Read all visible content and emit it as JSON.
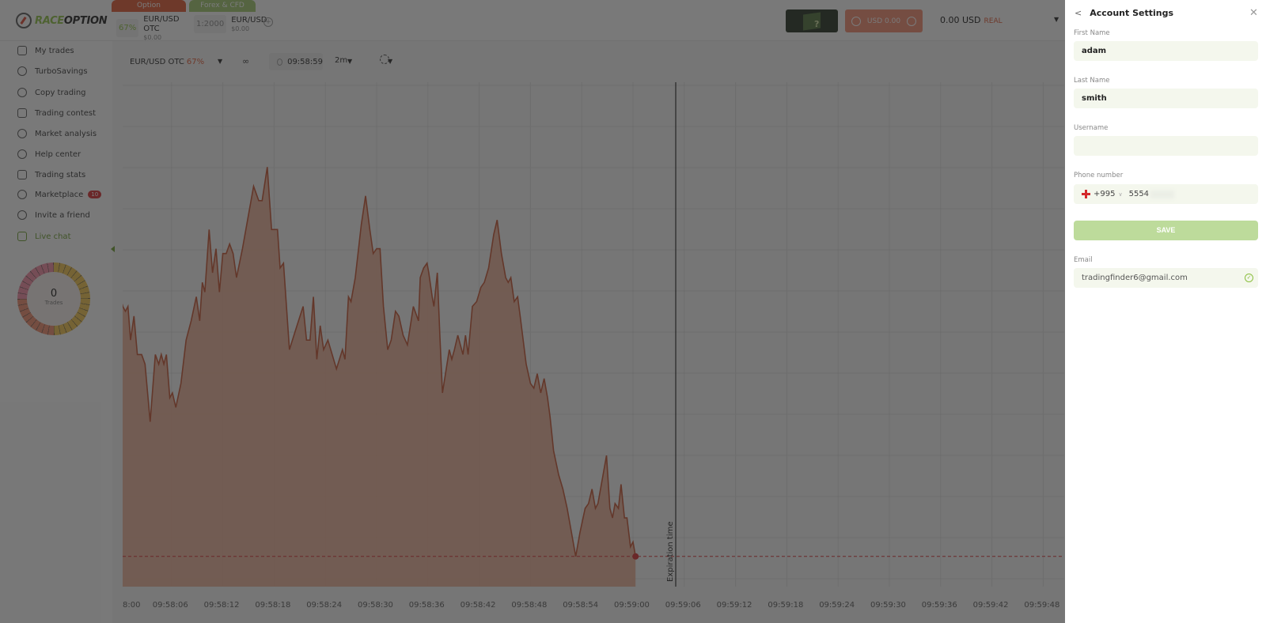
{
  "brand": {
    "name_part1": "RACE",
    "name_part2": "OPTION"
  },
  "header": {
    "tabs": [
      {
        "label": "Option",
        "payout": "67%",
        "asset": "EUR/USD OTC",
        "amount": "$0.00",
        "color": "#e0542f"
      },
      {
        "label": "Forex & CFD",
        "payout": "1:2000",
        "asset": "EUR/USD",
        "amount": "$0.00",
        "color": "#9dc56b"
      }
    ],
    "add_asset_icon": "plus-circle-icon",
    "gift_icon": "mystery-box-icon",
    "bonus_button": {
      "label": "USD 0.00"
    },
    "balance": {
      "amount": "0.00 USD",
      "account_type": "REAL"
    }
  },
  "sidebar": {
    "items": [
      {
        "label": "My trades",
        "icon": "trades-icon"
      },
      {
        "label": "TurboSavings",
        "icon": "savings-icon"
      },
      {
        "label": "Copy trading",
        "icon": "copy-trading-icon"
      },
      {
        "label": "Trading contest",
        "icon": "contest-icon"
      },
      {
        "label": "Market analysis",
        "icon": "analysis-icon"
      },
      {
        "label": "Help center",
        "icon": "help-icon"
      },
      {
        "label": "Trading stats",
        "icon": "stats-icon"
      },
      {
        "label": "Marketplace",
        "icon": "marketplace-icon",
        "badge": "10"
      },
      {
        "label": "Invite a friend",
        "icon": "invite-icon"
      },
      {
        "label": "Live chat",
        "icon": "chat-icon"
      }
    ],
    "trades_counter": {
      "count": "0",
      "label": "Trades"
    }
  },
  "chart_toolbar": {
    "symbol": "EUR/USD OTC",
    "symbol_payout": "67%",
    "timer": "09:58:59",
    "timeframe": "2m"
  },
  "chart_data": {
    "type": "area",
    "title": "EUR/USD OTC",
    "xlabel": "",
    "ylabel": "",
    "x_tick_labels": [
      "8:00",
      "09:58:06",
      "09:58:12",
      "09:58:18",
      "09:58:24",
      "09:58:30",
      "09:58:36",
      "09:58:42",
      "09:58:48",
      "09:58:54",
      "09:59:00",
      "09:59:06",
      "09:59:12",
      "09:59:18",
      "09:59:24",
      "09:59:30",
      "09:59:36",
      "09:59:42",
      "09:59:48"
    ],
    "x_range_seconds": [
      0,
      108
    ],
    "y_range": [
      0,
      100
    ],
    "grid": true,
    "annotation": "Expiration time",
    "expiration_x_seconds": 65,
    "current_level": 3,
    "series": [
      {
        "name": "price",
        "color": "#c2502e",
        "points": [
          [
            0.0,
            57
          ],
          [
            0.3,
            55
          ],
          [
            0.6,
            54
          ],
          [
            0.9,
            55
          ],
          [
            1.2,
            48
          ],
          [
            1.6,
            53
          ],
          [
            2.0,
            45
          ],
          [
            2.5,
            45
          ],
          [
            2.9,
            43
          ],
          [
            3.5,
            31
          ],
          [
            4.1,
            45
          ],
          [
            4.5,
            43
          ],
          [
            4.8,
            45
          ],
          [
            5.1,
            43
          ],
          [
            5.4,
            45
          ],
          [
            5.8,
            36
          ],
          [
            6.1,
            37
          ],
          [
            6.5,
            34
          ],
          [
            7.1,
            39
          ],
          [
            7.7,
            48
          ],
          [
            8.3,
            52
          ],
          [
            8.9,
            57
          ],
          [
            9.3,
            52
          ],
          [
            9.6,
            60
          ],
          [
            9.9,
            58
          ],
          [
            10.4,
            71
          ],
          [
            10.8,
            62
          ],
          [
            11.2,
            67
          ],
          [
            11.6,
            58
          ],
          [
            12.0,
            66
          ],
          [
            12.4,
            66
          ],
          [
            12.8,
            68
          ],
          [
            13.2,
            66
          ],
          [
            13.6,
            61
          ],
          [
            14.3,
            67
          ],
          [
            14.9,
            73
          ],
          [
            15.6,
            80
          ],
          [
            16.2,
            77
          ],
          [
            16.6,
            77
          ],
          [
            17.2,
            84
          ],
          [
            17.7,
            71
          ],
          [
            18.0,
            71
          ],
          [
            18.4,
            71
          ],
          [
            18.7,
            63
          ],
          [
            19.1,
            64
          ],
          [
            19.8,
            46
          ],
          [
            20.5,
            50
          ],
          [
            21.4,
            55
          ],
          [
            21.8,
            48
          ],
          [
            22.2,
            48
          ],
          [
            22.6,
            57
          ],
          [
            23.0,
            44
          ],
          [
            23.4,
            51
          ],
          [
            23.8,
            46
          ],
          [
            24.3,
            48
          ],
          [
            25.3,
            42
          ],
          [
            26.0,
            46
          ],
          [
            26.3,
            44
          ],
          [
            26.7,
            57
          ],
          [
            27.0,
            56
          ],
          [
            27.5,
            61
          ],
          [
            28.2,
            72
          ],
          [
            28.7,
            78
          ],
          [
            29.2,
            71
          ],
          [
            29.6,
            66
          ],
          [
            30.0,
            67
          ],
          [
            30.4,
            67
          ],
          [
            30.8,
            55
          ],
          [
            31.3,
            46
          ],
          [
            31.7,
            48
          ],
          [
            32.2,
            54
          ],
          [
            32.6,
            53
          ],
          [
            33.1,
            49
          ],
          [
            33.6,
            47
          ],
          [
            34.3,
            55
          ],
          [
            34.9,
            52
          ],
          [
            35.1,
            61
          ],
          [
            35.5,
            63
          ],
          [
            35.9,
            64
          ],
          [
            36.1,
            62
          ],
          [
            36.5,
            57
          ],
          [
            36.7,
            55
          ],
          [
            37.1,
            62
          ],
          [
            37.4,
            49
          ],
          [
            37.7,
            37
          ],
          [
            38.5,
            46
          ],
          [
            38.8,
            44
          ],
          [
            39.1,
            46
          ],
          [
            39.5,
            49
          ],
          [
            39.8,
            47
          ],
          [
            40.1,
            45
          ],
          [
            40.4,
            49
          ],
          [
            40.7,
            45
          ],
          [
            41.2,
            55
          ],
          [
            41.7,
            56
          ],
          [
            42.2,
            59
          ],
          [
            42.6,
            60
          ],
          [
            43.1,
            63
          ],
          [
            43.7,
            70
          ],
          [
            44.1,
            73
          ],
          [
            44.6,
            66
          ],
          [
            45.1,
            61
          ],
          [
            45.4,
            60
          ],
          [
            45.7,
            61
          ],
          [
            46.1,
            56
          ],
          [
            46.5,
            57
          ],
          [
            46.8,
            53
          ],
          [
            47.5,
            43
          ],
          [
            48.0,
            39
          ],
          [
            48.4,
            38
          ],
          [
            48.8,
            41
          ],
          [
            49.2,
            37
          ],
          [
            49.6,
            40
          ],
          [
            50.0,
            36
          ],
          [
            50.3,
            32
          ],
          [
            50.7,
            25
          ],
          [
            51.3,
            20
          ],
          [
            51.8,
            17
          ],
          [
            52.3,
            13
          ],
          [
            52.8,
            8
          ],
          [
            53.3,
            3
          ],
          [
            53.8,
            8
          ],
          [
            54.4,
            13
          ],
          [
            54.8,
            14
          ],
          [
            55.2,
            17
          ],
          [
            55.6,
            13
          ],
          [
            55.9,
            14
          ],
          [
            56.5,
            20
          ],
          [
            56.9,
            24
          ],
          [
            57.3,
            13
          ],
          [
            57.6,
            11
          ],
          [
            57.9,
            14
          ],
          [
            58.3,
            13
          ],
          [
            58.6,
            18
          ],
          [
            59.0,
            11
          ],
          [
            59.3,
            11
          ],
          [
            59.7,
            5
          ],
          [
            60.0,
            6
          ],
          [
            60.3,
            3
          ]
        ]
      }
    ]
  },
  "account_settings": {
    "title": "Account Settings",
    "fields": {
      "first_name": {
        "label": "First Name",
        "value": "adam"
      },
      "last_name": {
        "label": "Last Name",
        "value": "smith"
      },
      "username": {
        "label": "Username",
        "value": ""
      },
      "phone": {
        "label": "Phone number",
        "country_code": "+995",
        "value": "5554"
      },
      "email": {
        "label": "Email",
        "value": "tradingfinder6@gmail.com"
      }
    },
    "save_label": "SAVE"
  }
}
